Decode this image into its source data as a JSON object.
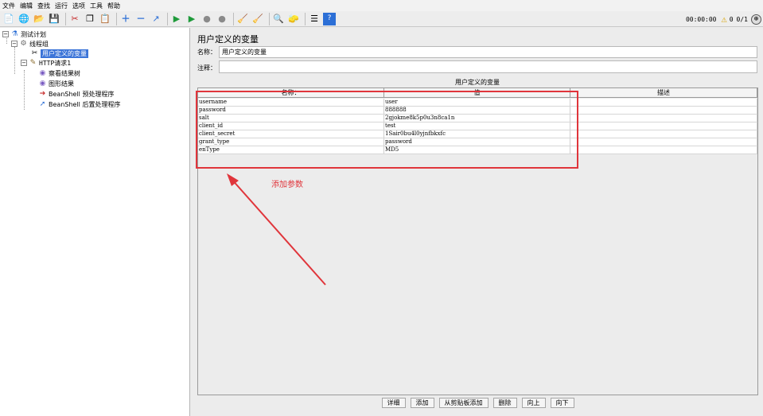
{
  "menu": [
    "文件",
    "编辑",
    "查找",
    "运行",
    "选项",
    "工具",
    "帮助"
  ],
  "status": {
    "timer": "00:00:00",
    "warnings": "0",
    "threads": "0/1"
  },
  "tree": {
    "test_plan": "测试计划",
    "thread_group": "线程组",
    "user_vars": "用户定义的变量",
    "http_request": "HTTP请求1",
    "view_results_tree": "察看结果树",
    "graph_results": "图形结果",
    "beanshell_pre": "BeanShell 预处理程序",
    "beanshell_post": "BeanShell 后置处理程序"
  },
  "panel": {
    "title": "用户定义的变量",
    "name_label": "名称：",
    "name_value": "用户定义的变量",
    "comment_label": "注释：",
    "comment_value": "",
    "table_title": "用户定义的变量"
  },
  "table": {
    "headers": [
      "名称：",
      "值",
      "描述"
    ],
    "rows": [
      [
        "username",
        "user",
        ""
      ],
      [
        "password",
        "888888",
        ""
      ],
      [
        "salt",
        "2gjokme8k5p0u3n8ca1n",
        ""
      ],
      [
        "client_id",
        "test",
        ""
      ],
      [
        "client_secret",
        "1Sair0bu4l0yjnfbkxfc",
        ""
      ],
      [
        "grant_type",
        "password",
        ""
      ],
      [
        "enType",
        "MD5",
        ""
      ]
    ]
  },
  "annotation": "添加参数",
  "buttons": [
    "详细",
    "添加",
    "从剪贴板添加",
    "删除",
    "向上",
    "向下"
  ],
  "colors": {
    "selection": "#3b74d8",
    "annotation": "#e0353b"
  }
}
